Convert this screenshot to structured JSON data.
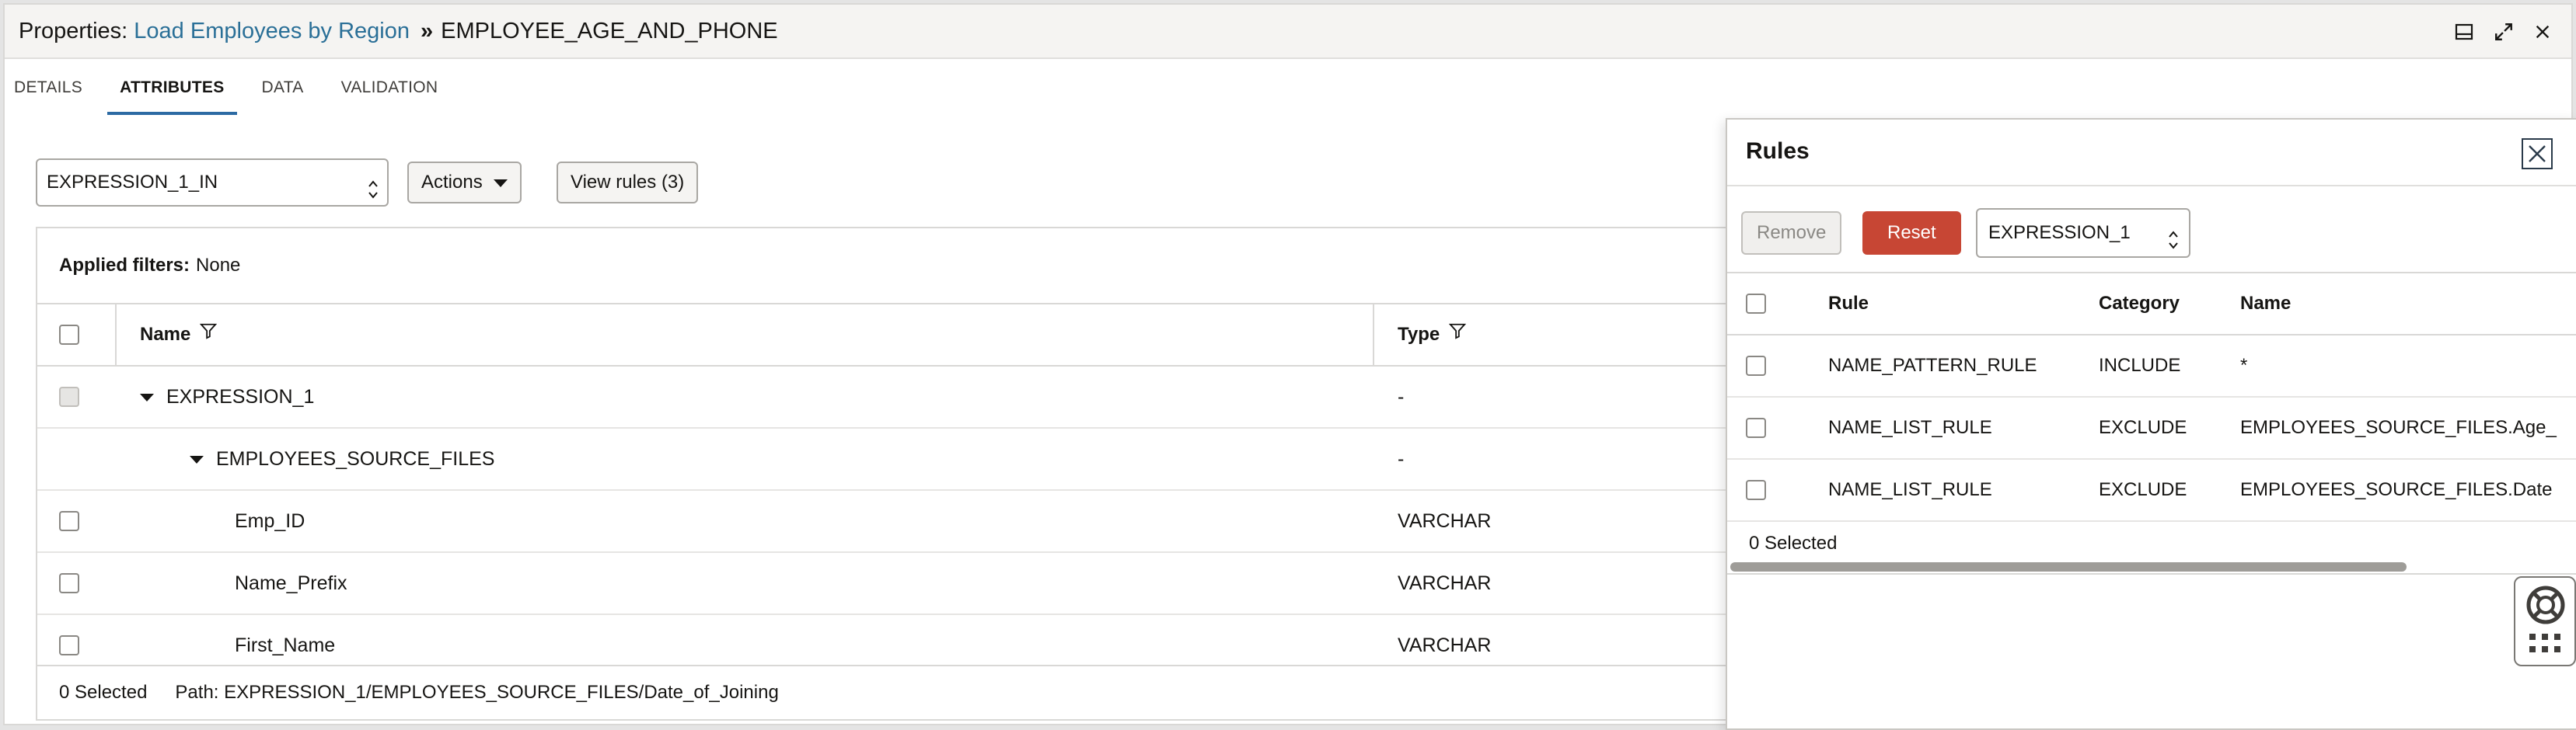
{
  "header": {
    "prefix": "Properties: ",
    "task_link": "Load Employees by Region",
    "separator": "»",
    "object_name": "EMPLOYEE_AGE_AND_PHONE",
    "icons": [
      "panel-layout-icon",
      "expand-icon",
      "close-icon"
    ]
  },
  "tabs": [
    {
      "label": "DETAILS",
      "active": false
    },
    {
      "label": "ATTRIBUTES",
      "active": true
    },
    {
      "label": "DATA",
      "active": false
    },
    {
      "label": "VALIDATION",
      "active": false
    }
  ],
  "toolbar": {
    "port_select": "EXPRESSION_1_IN",
    "actions_label": "Actions",
    "view_rules_label": "View rules (3)"
  },
  "grid": {
    "applied_filters_label": "Applied filters:",
    "applied_filters_value": "None",
    "columns": {
      "name": "Name",
      "type": "Type"
    },
    "rows": [
      {
        "name": "EXPRESSION_1",
        "type": "-",
        "level": 0,
        "expanded": true
      },
      {
        "name": "EMPLOYEES_SOURCE_FILES",
        "type": "-",
        "level": 1,
        "expanded": true
      },
      {
        "name": "Emp_ID",
        "type": "VARCHAR",
        "level": 2
      },
      {
        "name": "Name_Prefix",
        "type": "VARCHAR",
        "level": 2
      },
      {
        "name": "First_Name",
        "type": "VARCHAR",
        "level": 2
      }
    ],
    "selected_count": "0 Selected",
    "path": "Path: EXPRESSION_1/EMPLOYEES_SOURCE_FILES/Date_of_Joining"
  },
  "rules_panel": {
    "title": "Rules",
    "remove_label": "Remove",
    "reset_label": "Reset",
    "select_value": "EXPRESSION_1",
    "columns": {
      "rule": "Rule",
      "category": "Category",
      "name": "Name"
    },
    "rows": [
      {
        "rule": "NAME_PATTERN_RULE",
        "category": "INCLUDE",
        "name": "*"
      },
      {
        "rule": "NAME_LIST_RULE",
        "category": "EXCLUDE",
        "name": "EMPLOYEES_SOURCE_FILES.Age_"
      },
      {
        "rule": "NAME_LIST_RULE",
        "category": "EXCLUDE",
        "name": "EMPLOYEES_SOURCE_FILES.Date"
      }
    ],
    "selected_count": "0 Selected"
  },
  "colors": {
    "link": "#2a6f97",
    "active_tab": "#2c6aa3",
    "reset_button": "#c74634",
    "border": "#d9d8d6"
  }
}
